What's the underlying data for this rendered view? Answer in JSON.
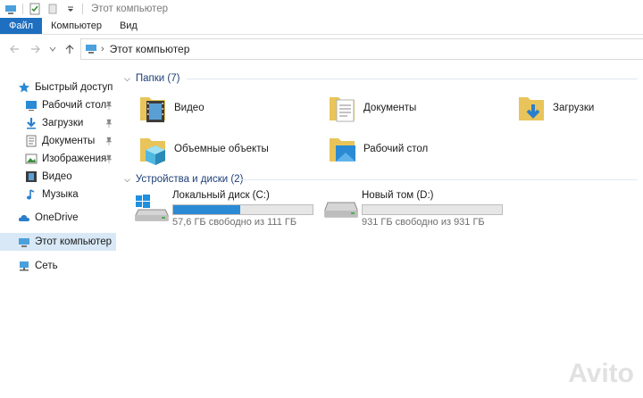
{
  "window": {
    "title": "Этот компьютер"
  },
  "ribbon": {
    "tabs": [
      "Файл",
      "Компьютер",
      "Вид"
    ]
  },
  "address": {
    "crumb": "Этот компьютер"
  },
  "sidebar": {
    "items": [
      {
        "label": "Быстрый доступ",
        "icon": "star-icon"
      },
      {
        "label": "Рабочий стол",
        "icon": "desktop-icon",
        "pinned": true
      },
      {
        "label": "Загрузки",
        "icon": "download-icon",
        "pinned": true
      },
      {
        "label": "Документы",
        "icon": "documents-icon",
        "pinned": true
      },
      {
        "label": "Изображения",
        "icon": "pictures-icon",
        "pinned": true
      },
      {
        "label": "Видео",
        "icon": "video-icon"
      },
      {
        "label": "Музыка",
        "icon": "music-icon"
      },
      {
        "label": "OneDrive",
        "icon": "cloud-icon"
      },
      {
        "label": "Этот компьютер",
        "icon": "computer-icon",
        "selected": true
      },
      {
        "label": "Сеть",
        "icon": "network-icon"
      }
    ]
  },
  "folders": {
    "header": "Папки (7)",
    "items": [
      {
        "label": "Видео",
        "icon": "video-folder-icon"
      },
      {
        "label": "Документы",
        "icon": "documents-folder-icon"
      },
      {
        "label": "Загрузки",
        "icon": "downloads-folder-icon"
      },
      {
        "label": "Объемные объекты",
        "icon": "3d-objects-folder-icon"
      },
      {
        "label": "Рабочий стол",
        "icon": "desktop-folder-icon"
      }
    ]
  },
  "drives": {
    "header": "Устройства и диски (2)",
    "items": [
      {
        "name": "Локальный диск (C:)",
        "free": "57,6 ГБ свободно из 111 ГБ",
        "used_fraction": 0.48,
        "icon": "system-drive-icon"
      },
      {
        "name": "Новый том (D:)",
        "free": "931 ГБ свободно из 931 ГБ",
        "used_fraction": 0.0,
        "icon": "drive-icon"
      }
    ]
  },
  "watermark": "Avito",
  "colors": {
    "accent": "#1e6fc0",
    "selection": "#d9e8f6",
    "drive_fill": "#2a8ad4",
    "group_header": "#1e3e78"
  }
}
